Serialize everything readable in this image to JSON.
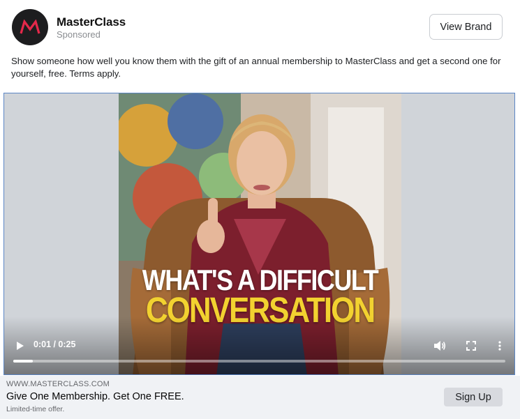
{
  "header": {
    "brand_name": "MasterClass",
    "sponsored_label": "Sponsored",
    "view_brand_label": "View Brand",
    "logo_color": "#e4284a"
  },
  "post": {
    "caption": "Show someone how well you know them with the gift of an annual membership to MasterClass and get a second one for yourself, free. Terms apply."
  },
  "video": {
    "overlay_line1": "WHAT'S A DIFFICULT",
    "overlay_line2": "CONVERSATION",
    "time_display": "0:01 / 0:25",
    "progress_fraction": 0.04,
    "icons": [
      "play-icon",
      "volume-icon",
      "fullscreen-icon",
      "more-vertical-icon"
    ]
  },
  "footer": {
    "domain": "WWW.MASTERCLASS.COM",
    "headline": "Give One Membership. Get One FREE.",
    "description": "Limited-time offer.",
    "cta_label": "Sign Up"
  }
}
